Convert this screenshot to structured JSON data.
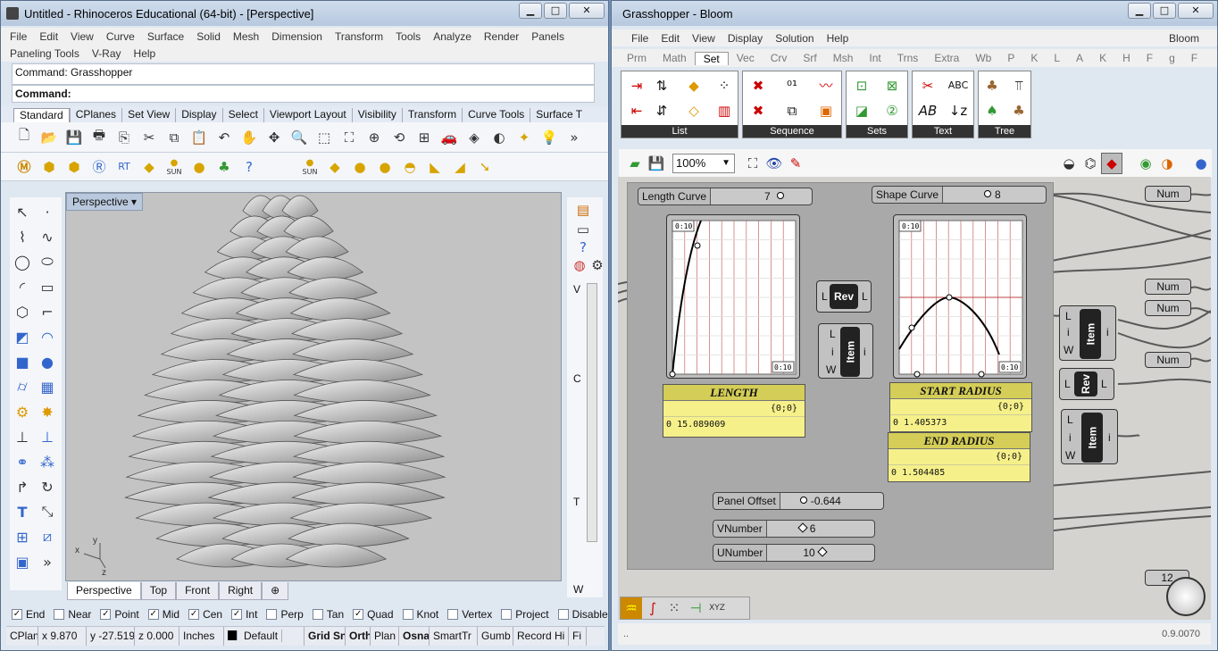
{
  "rhino": {
    "title": "Untitled - Rhinoceros Educational (64-bit) - [Perspective]",
    "menu1": [
      "File",
      "Edit",
      "View",
      "Curve",
      "Surface",
      "Solid",
      "Mesh",
      "Dimension",
      "Transform",
      "Tools",
      "Analyze",
      "Render",
      "Panels"
    ],
    "menu2": [
      "Paneling Tools",
      "V-Ray",
      "Help"
    ],
    "command_history": "Command: Grasshopper",
    "command_prompt": "Command:",
    "tabs": [
      "Standard",
      "CPlanes",
      "Set View",
      "Display",
      "Select",
      "Viewport Layout",
      "Visibility",
      "Transform",
      "Curve Tools",
      "Surface T"
    ],
    "toolbar2_labels": [
      "SUN",
      "SUN"
    ],
    "viewport_title": "Perspective",
    "axis_labels": {
      "x": "x",
      "y": "y",
      "z": "z"
    },
    "viewport_tabs": [
      "Perspective",
      "Top",
      "Front",
      "Right"
    ],
    "right_panel_letters": [
      "V",
      "C",
      "T",
      "W"
    ],
    "osnaps": [
      {
        "label": "End",
        "checked": true
      },
      {
        "label": "Near",
        "checked": false
      },
      {
        "label": "Point",
        "checked": true
      },
      {
        "label": "Mid",
        "checked": true
      },
      {
        "label": "Cen",
        "checked": true
      },
      {
        "label": "Int",
        "checked": true
      },
      {
        "label": "Perp",
        "checked": false
      },
      {
        "label": "Tan",
        "checked": false
      },
      {
        "label": "Quad",
        "checked": true
      },
      {
        "label": "Knot",
        "checked": false
      },
      {
        "label": "Vertex",
        "checked": false
      },
      {
        "label": "Project",
        "checked": false
      },
      {
        "label": "Disable",
        "checked": false
      }
    ],
    "status": {
      "cplane": "CPlan",
      "x": "x 9.870",
      "y": "y -27.519",
      "z": "z 0.000",
      "units": "Inches",
      "layer": "Default",
      "grid_snap": "Grid Sn",
      "ortho": "Orth",
      "planar": "Plan",
      "osnap": "Osna",
      "smarttrack": "SmartTr",
      "gumball": "Gumb",
      "record_history": "Record Hi",
      "filter": "Fi"
    }
  },
  "grasshopper": {
    "title": "Grasshopper - Bloom",
    "menu": [
      "File",
      "Edit",
      "View",
      "Display",
      "Solution",
      "Help"
    ],
    "menu_right": "Bloom",
    "tabs": [
      "Prm",
      "Math",
      "Set",
      "Vec",
      "Crv",
      "Srf",
      "Msh",
      "Int",
      "Trns",
      "Extra",
      "Wb",
      "P",
      "K",
      "L",
      "A",
      "K",
      "H",
      "F",
      "g",
      "F"
    ],
    "active_tab": "Set",
    "ribbon_groups": [
      "List",
      "Sequence",
      "Sets",
      "Text",
      "Tree"
    ],
    "zoom": "100%",
    "sliders": [
      {
        "label": "Length Curve",
        "value": "7"
      },
      {
        "label": "Shape Curve",
        "value": "8"
      },
      {
        "label": "Panel Offset",
        "value": "-0.644"
      },
      {
        "label": "VNumber",
        "value": "6"
      },
      {
        "label": "UNumber",
        "value": "10"
      }
    ],
    "graph_range_label": "0:10",
    "panels": [
      {
        "title": "LENGTH",
        "path": "{0;0}",
        "index": "0",
        "value": "15.089009"
      },
      {
        "title": "START RADIUS",
        "path": "{0;0}",
        "index": "0",
        "value": "1.405373"
      },
      {
        "title": "END RADIUS",
        "path": "{0;0}",
        "index": "0",
        "value": "1.504485"
      }
    ],
    "rev_label": "Rev",
    "item_label": "Item",
    "io_L": "L",
    "io_i": "i",
    "io_W": "W",
    "num_label": "Num",
    "partial_num": "12",
    "version": "0.9.0070"
  }
}
